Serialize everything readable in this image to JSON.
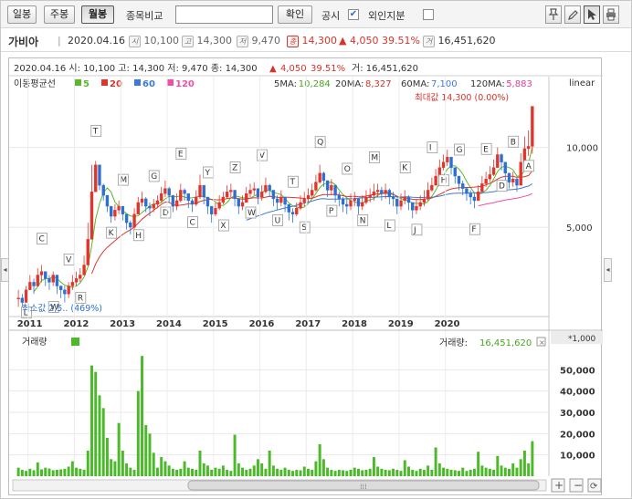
{
  "toolbar": {
    "tabs": [
      {
        "label": "일봉",
        "active": false
      },
      {
        "label": "주봉",
        "active": false
      },
      {
        "label": "월봉",
        "active": true
      }
    ],
    "compare_label": "종목비교",
    "search_value": "",
    "confirm_label": "확인",
    "disclosure_label": "공시",
    "disclosure_checked": true,
    "foreign_label": "외인지분",
    "foreign_checked": false,
    "check_mark": "✔",
    "right_icons": [
      "pin-icon",
      "pencil-icon",
      "cursor-icon",
      "print-icon"
    ]
  },
  "info": {
    "name": "가비아",
    "date": "2020.04.16",
    "open_badge": "시",
    "open": "10,100",
    "high_badge": "고",
    "high": "14,300",
    "low_badge": "저",
    "low": "9,470",
    "close_badge": "종",
    "close": "14,300",
    "change_arrow": "▲",
    "change": "4,050",
    "change_pct": "39.51%",
    "volume_badge": "거",
    "volume": "16,451,620"
  },
  "chart_header": {
    "line1_prefix": "2020.04.16 시: 10,100 고: 14,300 저: 9,470 종: 14,300",
    "line1_arrow": "▲",
    "line1_change": "4,050",
    "line1_pct": "39.51%",
    "line1_vol": "거: 16,451,620",
    "legend_title": "이동평균선",
    "legend": [
      {
        "label": "5",
        "color": "#5cb82b"
      },
      {
        "label": "20",
        "color": "#e0352b"
      },
      {
        "label": "60",
        "color": "#3c7ad8"
      },
      {
        "label": "120",
        "color": "#f04fa8"
      }
    ],
    "ma_values": [
      {
        "label": "5MA:",
        "value": "10,284",
        "color": "#4aa51f"
      },
      {
        "label": "20MA:",
        "value": "8,327",
        "color": "#d8332b"
      },
      {
        "label": "60MA:",
        "value": "7,100",
        "color": "#3c7ad8"
      },
      {
        "label": "120MA:",
        "value": "5,883",
        "color": "#e0409a"
      }
    ],
    "scale_mode": "linear",
    "max_annotation": "최대값 14,300 (0.00%)",
    "min_annotation": "최소값 2,5.. (469%)"
  },
  "volume_header": {
    "title": "거래량",
    "value_label": "거래량:",
    "value": "16,451,620",
    "unit": "*1,000"
  },
  "colors": {
    "up": "#e0352b",
    "down": "#2c6fd1",
    "volume": "#4cb92a",
    "grid": "#e8e8e8",
    "text": "#333333"
  },
  "chart_data": [
    {
      "type": "candlestick",
      "name": "price",
      "x_ticks": [
        "2011",
        "2012",
        "2013",
        "2014",
        "2015",
        "2016",
        "2017",
        "2018",
        "2019",
        "2020"
      ],
      "y_ticks": [
        5000,
        10000
      ],
      "y_tick_labels": [
        "5,000",
        "10,000"
      ],
      "yscale": "log",
      "ylim": [
        2300,
        15800
      ],
      "start": "2010-10",
      "close": [
        2.7,
        2.6,
        2.9,
        3.1,
        3.0,
        3.3,
        3.4,
        3.2,
        3.1,
        3.3,
        3.0,
        2.9,
        2.8,
        3.0,
        3.1,
        3.2,
        3.3,
        3.6,
        4.5,
        6.8,
        8.6,
        7.2,
        6.6,
        6.0,
        5.5,
        5.8,
        6.0,
        5.6,
        5.2,
        5.0,
        5.6,
        6.2,
        6.4,
        6.0,
        5.9,
        6.1,
        6.3,
        6.7,
        7.0,
        6.6,
        6.0,
        6.3,
        6.9,
        6.7,
        6.3,
        6.1,
        6.5,
        7.2,
        6.5,
        6.0,
        5.6,
        5.9,
        6.2,
        6.5,
        6.8,
        6.9,
        6.4,
        6.0,
        6.2,
        6.7,
        6.9,
        7.0,
        6.5,
        6.8,
        7.2,
        6.9,
        6.4,
        6.2,
        6.5,
        6.1,
        5.7,
        5.6,
        5.9,
        6.2,
        6.4,
        6.6,
        6.9,
        7.4,
        8.0,
        7.5,
        6.9,
        7.2,
        6.6,
        6.4,
        6.1,
        6.0,
        6.3,
        6.4,
        6.0,
        6.2,
        6.5,
        6.6,
        6.8,
        6.9,
        6.7,
        6.9,
        6.5,
        6.4,
        6.0,
        6.3,
        6.5,
        6.2,
        5.8,
        6.0,
        6.2,
        6.4,
        6.9,
        7.2,
        7.8,
        8.4,
        8.8,
        9.2,
        8.4,
        7.8,
        7.3,
        7.0,
        6.7,
        6.5,
        6.3,
        6.8,
        7.3,
        7.6,
        7.9,
        8.4,
        9.4,
        8.8,
        8.0,
        7.4,
        7.6,
        7.2,
        8.8,
        9.9,
        10.1,
        14.3
      ],
      "high": [
        2.9,
        2.8,
        3.0,
        3.3,
        3.2,
        3.5,
        3.6,
        3.4,
        3.3,
        3.4,
        3.2,
        3.0,
        3.0,
        3.1,
        3.3,
        3.4,
        3.5,
        3.9,
        5.2,
        8.6,
        8.9,
        8.1,
        7.3,
        6.6,
        5.9,
        6.1,
        6.3,
        6.0,
        5.6,
        5.3,
        5.9,
        6.5,
        6.8,
        6.5,
        6.2,
        6.4,
        6.6,
        7.1,
        7.5,
        7.1,
        6.4,
        6.7,
        7.3,
        7.0,
        6.7,
        6.4,
        6.9,
        7.9,
        7.1,
        6.4,
        6.0,
        6.2,
        6.6,
        6.8,
        7.2,
        7.3,
        6.9,
        6.4,
        6.6,
        7.1,
        7.3,
        7.4,
        7.0,
        7.2,
        7.7,
        7.3,
        6.9,
        6.6,
        6.9,
        6.5,
        6.1,
        5.9,
        6.2,
        6.6,
        6.8,
        7.0,
        7.3,
        7.9,
        8.6,
        8.1,
        7.4,
        7.6,
        7.1,
        6.8,
        6.5,
        6.4,
        6.7,
        6.8,
        6.4,
        6.6,
        6.9,
        7.0,
        7.3,
        7.3,
        7.1,
        7.3,
        7.0,
        6.8,
        6.4,
        6.7,
        6.9,
        6.6,
        6.2,
        6.4,
        6.6,
        6.9,
        7.4,
        7.7,
        8.3,
        9.0,
        9.4,
        9.8,
        9.0,
        8.4,
        7.8,
        7.5,
        7.1,
        6.9,
        6.7,
        7.2,
        7.8,
        8.1,
        8.5,
        9.0,
        10.0,
        9.5,
        8.6,
        7.9,
        8.1,
        7.7,
        9.5,
        11.0,
        11.6,
        14.3
      ],
      "low": [
        2.5,
        2.4,
        2.6,
        2.9,
        2.8,
        3.0,
        3.1,
        3.0,
        2.9,
        3.0,
        2.8,
        2.7,
        2.6,
        2.7,
        2.9,
        3.0,
        3.1,
        3.3,
        3.9,
        4.6,
        7.0,
        6.9,
        6.3,
        5.7,
        5.2,
        5.3,
        5.6,
        5.3,
        4.9,
        4.7,
        4.9,
        5.6,
        6.0,
        5.7,
        5.5,
        5.7,
        5.9,
        6.2,
        6.5,
        6.2,
        5.7,
        5.8,
        6.2,
        6.3,
        5.9,
        5.7,
        6.0,
        6.4,
        6.1,
        5.6,
        5.2,
        5.5,
        5.8,
        6.1,
        6.4,
        6.5,
        6.0,
        5.6,
        5.8,
        6.2,
        6.5,
        6.6,
        6.1,
        6.3,
        6.7,
        6.5,
        6.0,
        5.8,
        6.0,
        5.7,
        5.3,
        5.2,
        5.5,
        5.8,
        6.0,
        6.2,
        6.4,
        6.8,
        7.3,
        7.1,
        6.5,
        6.6,
        6.2,
        6.0,
        5.7,
        5.6,
        5.8,
        6.0,
        5.6,
        5.8,
        6.1,
        6.2,
        6.3,
        6.5,
        6.3,
        6.4,
        6.1,
        6.0,
        5.6,
        5.8,
        6.1,
        5.8,
        5.4,
        5.6,
        5.8,
        6.0,
        6.3,
        6.8,
        7.2,
        7.8,
        8.2,
        8.5,
        7.9,
        7.3,
        6.9,
        6.6,
        6.3,
        6.1,
        5.9,
        6.3,
        6.8,
        7.1,
        7.4,
        7.8,
        8.6,
        8.2,
        7.5,
        7.0,
        7.1,
        6.8,
        7.5,
        9.0,
        9.3,
        9.47
      ]
    },
    {
      "type": "bar",
      "name": "volume",
      "y_ticks": [
        10000,
        20000,
        30000,
        40000,
        50000
      ],
      "y_tick_labels": [
        "10,000",
        "20,000",
        "30,000",
        "40,000",
        "50,000"
      ],
      "ylim": [
        0,
        60000
      ],
      "values": [
        4000,
        3000,
        2500,
        3500,
        2800,
        6500,
        3200,
        4000,
        3600,
        2800,
        3000,
        3200,
        3500,
        4500,
        7000,
        4000,
        3500,
        3000,
        12000,
        52000,
        49000,
        38000,
        32000,
        18000,
        8000,
        7000,
        25000,
        12000,
        6000,
        4000,
        3000,
        40000,
        56500,
        24000,
        20000,
        11000,
        4000,
        9000,
        7000,
        5000,
        3500,
        3000,
        3500,
        7000,
        4000,
        3500,
        3000,
        12000,
        6000,
        5000,
        3000,
        4000,
        3500,
        5000,
        3000,
        2500,
        19500,
        6000,
        4000,
        3000,
        3500,
        5000,
        8000,
        6000,
        3500,
        12000,
        5000,
        3500,
        3000,
        4000,
        3000,
        2500,
        3000,
        2800,
        4500,
        3500,
        3000,
        7000,
        15000,
        8000,
        4000,
        3000,
        2500,
        3000,
        2800,
        2500,
        3000,
        4000,
        3500,
        2800,
        3000,
        3500,
        9000,
        4500,
        3500,
        3000,
        2800,
        3500,
        3000,
        2500,
        7500,
        4500,
        3000,
        2500,
        3500,
        3000,
        5000,
        3000,
        13500,
        6000,
        4000,
        3500,
        3000,
        2800,
        2500,
        4000,
        2500,
        3000,
        3500,
        11500,
        5000,
        4000,
        3500,
        3000,
        9500,
        5000,
        4000,
        3500,
        6000,
        4000,
        8000,
        12000,
        6000,
        16451
      ]
    }
  ],
  "markers": [
    {
      "label": "L"
    },
    {
      "label": "C"
    },
    {
      "label": "W"
    },
    {
      "label": "V"
    },
    {
      "label": "R"
    },
    {
      "label": "T"
    },
    {
      "label": "K"
    },
    {
      "label": "M"
    },
    {
      "label": "H"
    },
    {
      "label": "G"
    },
    {
      "label": "D"
    },
    {
      "label": "E"
    },
    {
      "label": "C"
    },
    {
      "label": "Y"
    },
    {
      "label": "X"
    },
    {
      "label": "Z"
    },
    {
      "label": "W"
    },
    {
      "label": "V"
    },
    {
      "label": "U"
    },
    {
      "label": "T"
    },
    {
      "label": "S"
    },
    {
      "label": "Q"
    },
    {
      "label": "P"
    },
    {
      "label": "O"
    },
    {
      "label": "N"
    },
    {
      "label": "M"
    },
    {
      "label": "L"
    },
    {
      "label": "K"
    },
    {
      "label": "J"
    },
    {
      "label": "I"
    },
    {
      "label": "H"
    },
    {
      "label": "G"
    },
    {
      "label": "F"
    },
    {
      "label": "E"
    },
    {
      "label": "D"
    },
    {
      "label": "B"
    },
    {
      "label": "A"
    }
  ]
}
